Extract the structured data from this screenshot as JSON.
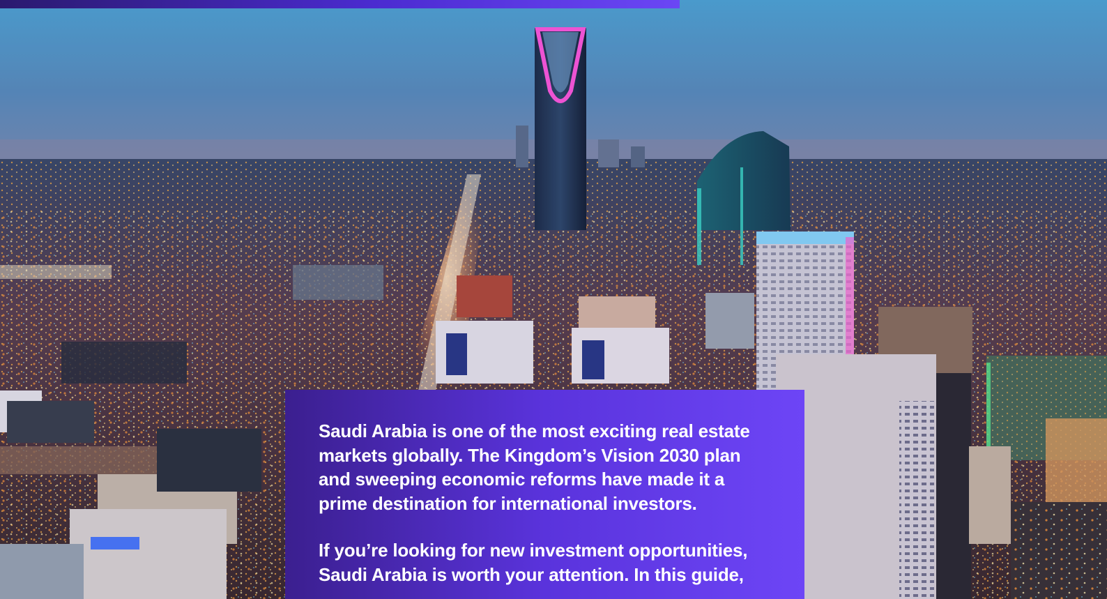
{
  "hero_image": {
    "description_icon": "city-skyline-night-photo"
  },
  "colors": {
    "brand_purple": "#6d45f6",
    "brand_deep": "#3b1f8f",
    "tower_glow": "#ff4fd8"
  },
  "intro": {
    "paragraph_1": "Saudi Arabia is one of the most exciting real estate markets globally. The Kingdom’s Vision 2030 plan and sweeping economic reforms have made it a prime destination for international investors.",
    "paragraph_2": "If you’re looking for new investment opportunities, Saudi Arabia is worth your attention. In this guide,"
  }
}
